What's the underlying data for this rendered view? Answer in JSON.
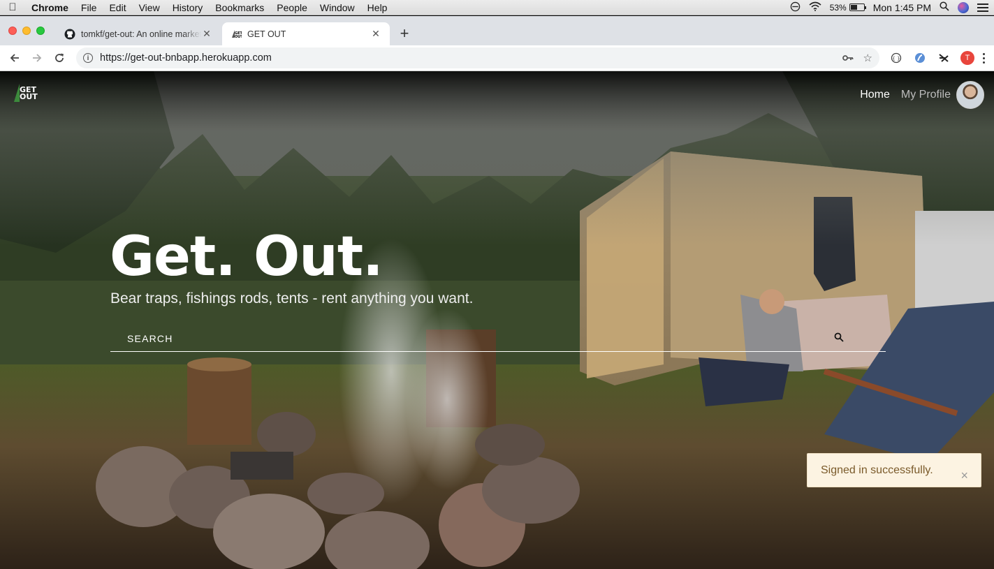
{
  "menubar": {
    "app": "Chrome",
    "items": [
      "File",
      "Edit",
      "View",
      "History",
      "Bookmarks",
      "People",
      "Window",
      "Help"
    ],
    "battery_percent": "53%",
    "battery_level": 0.53,
    "clock": "Mon 1:45 PM"
  },
  "browser": {
    "tabs": [
      {
        "title": "tomkf/get-out: An online marketplace",
        "favicon": "github-icon",
        "active": false
      },
      {
        "title": "GET OUT",
        "favicon": "get-out-favicon",
        "active": true
      }
    ],
    "url": "https://get-out-bnbapp.herokuapp.com",
    "profile_initial": "T"
  },
  "site": {
    "logo_text_1": "GET",
    "logo_text_2": "OUT",
    "nav": {
      "home": "Home",
      "profile": "My Profile"
    },
    "hero": {
      "title": "Get. Out.",
      "subtitle": "Bear traps, fishings rods, tents - rent anything you want.",
      "search_placeholder": "SEARCH"
    },
    "flash": "Signed in successfully.",
    "flash_close": "×"
  }
}
